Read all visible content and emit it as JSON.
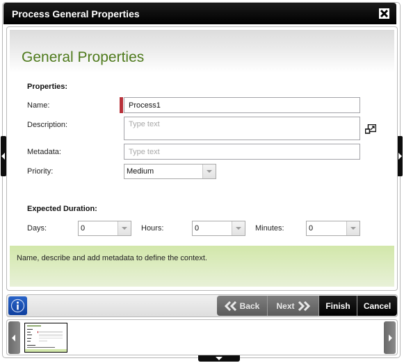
{
  "window": {
    "title": "Process General Properties"
  },
  "page": {
    "title": "General Properties"
  },
  "properties": {
    "section_label": "Properties:",
    "name": {
      "label": "Name:",
      "value": "Process1",
      "required": true
    },
    "description": {
      "label": "Description:",
      "value": "",
      "placeholder": "Type text"
    },
    "metadata": {
      "label": "Metadata:",
      "value": "",
      "placeholder": "Type text"
    },
    "priority": {
      "label": "Priority:",
      "selected": "Medium"
    }
  },
  "duration": {
    "section_label": "Expected Duration:",
    "days": {
      "label": "Days:",
      "selected": "0"
    },
    "hours": {
      "label": "Hours:",
      "selected": "0"
    },
    "minutes": {
      "label": "Minutes:",
      "selected": "0"
    }
  },
  "hint": {
    "text": "Name, describe and add metadata to define the context."
  },
  "toolbar": {
    "back_label": "Back",
    "next_label": "Next",
    "finish_label": "Finish",
    "cancel_label": "Cancel"
  },
  "icons": {
    "close": "close-icon",
    "expand": "expand-editor-icon",
    "info": "info-icon",
    "back": "double-chevron-left-icon",
    "next": "double-chevron-right-icon"
  },
  "colors": {
    "title_green": "#4e7a1c",
    "required_red": "#b8313a",
    "hint_green": "#d2e7aa",
    "info_blue": "#1d52b4"
  }
}
